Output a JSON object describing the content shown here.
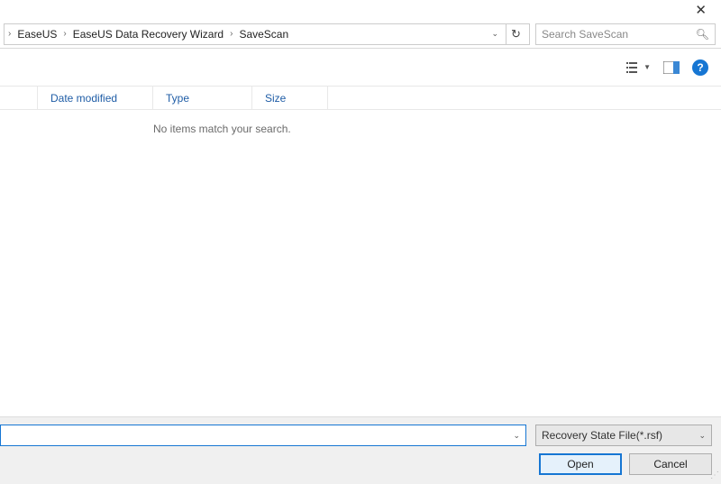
{
  "breadcrumbs": {
    "item0": "EaseUS",
    "item1": "EaseUS Data Recovery Wizard",
    "item2": "SaveScan"
  },
  "search": {
    "placeholder": "Search SaveScan"
  },
  "columns": {
    "date": "Date modified",
    "type": "Type",
    "size": "Size"
  },
  "content": {
    "empty_message": "No items match your search."
  },
  "footer": {
    "filename_value": "",
    "filter": "Recovery State File(*.rsf)",
    "open_label": "Open",
    "cancel_label": "Cancel"
  }
}
